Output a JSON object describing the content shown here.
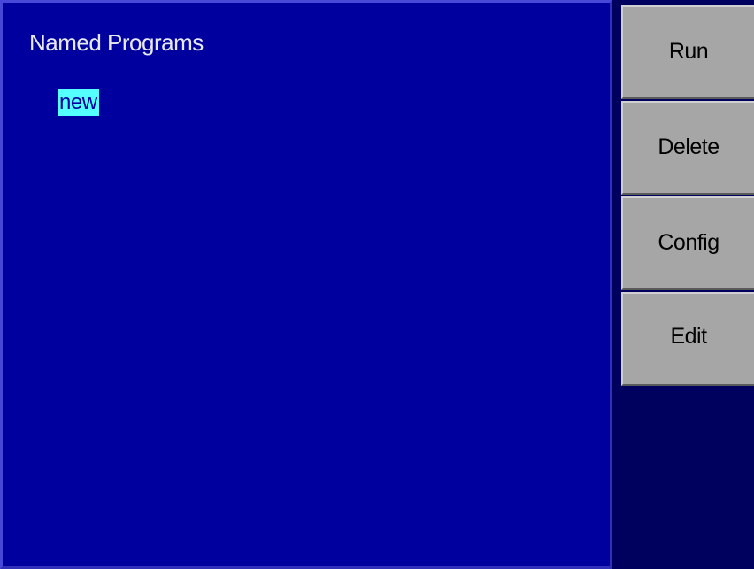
{
  "panel": {
    "title": "Named Programs",
    "programs": [
      {
        "name": "new",
        "selected": true
      }
    ]
  },
  "buttons": {
    "run": "Run",
    "delete": "Delete",
    "config": "Config",
    "edit": "Edit"
  },
  "colors": {
    "background": "#00005e",
    "panel": "#00009e",
    "selection": "#55ffff",
    "button": "#a6a6a6"
  }
}
